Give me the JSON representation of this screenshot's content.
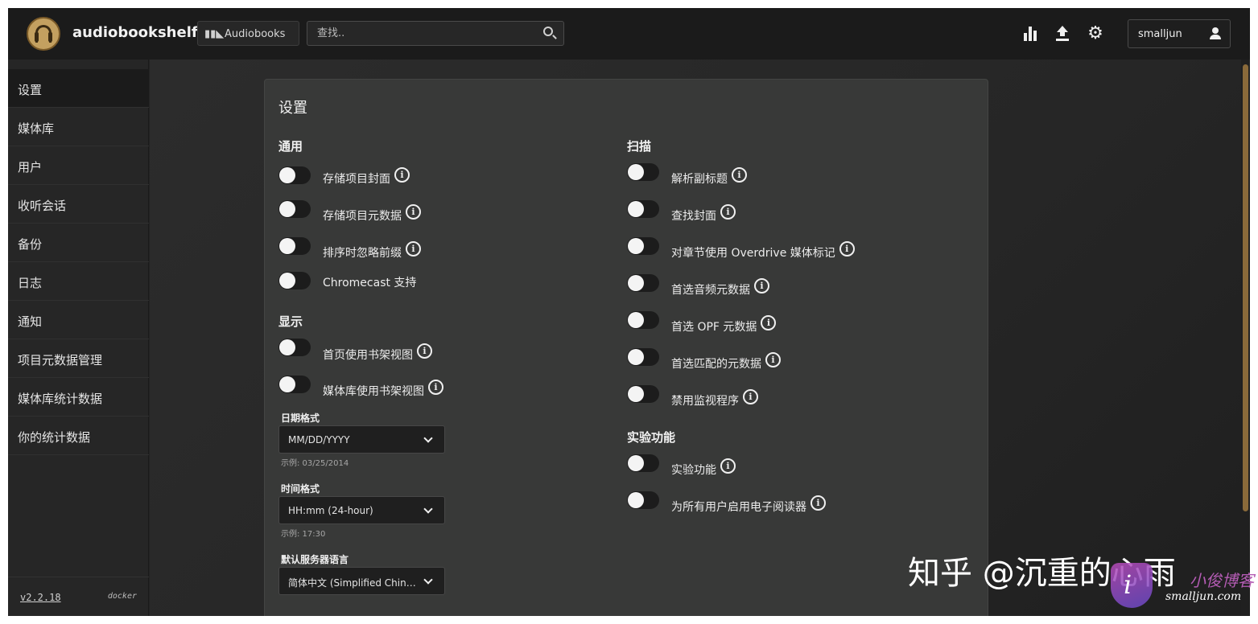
{
  "header": {
    "app_title": "audiobookshelf",
    "library_label": "Audiobooks",
    "search_placeholder": "查找..",
    "username": "smalljun"
  },
  "sidebar": {
    "items": [
      {
        "label": "设置",
        "active": true
      },
      {
        "label": "媒体库"
      },
      {
        "label": "用户"
      },
      {
        "label": "收听会话"
      },
      {
        "label": "备份"
      },
      {
        "label": "日志"
      },
      {
        "label": "通知"
      },
      {
        "label": "项目元数据管理"
      },
      {
        "label": "媒体库统计数据"
      },
      {
        "label": "你的统计数据"
      }
    ],
    "version": "v2.2.18",
    "deployment": "docker"
  },
  "settings": {
    "title": "设置",
    "general": {
      "title": "通用",
      "options": [
        {
          "label": "存储项目封面",
          "info": true,
          "enabled": false
        },
        {
          "label": "存储项目元数据",
          "info": true,
          "enabled": false
        },
        {
          "label": "排序时忽略前缀",
          "info": true,
          "enabled": false
        },
        {
          "label": "Chromecast 支持",
          "info": false,
          "enabled": false
        }
      ]
    },
    "display": {
      "title": "显示",
      "options": [
        {
          "label": "首页使用书架视图",
          "info": true,
          "enabled": false
        },
        {
          "label": "媒体库使用书架视图",
          "info": true,
          "enabled": false
        }
      ],
      "date_format": {
        "label": "日期格式",
        "value": "MM/DD/YYYY",
        "example": "示例: 03/25/2014"
      },
      "time_format": {
        "label": "时间格式",
        "value": "HH:mm (24-hour)",
        "example": "示例: 17:30"
      },
      "language": {
        "label": "默认服务器语言",
        "value": "简体中文 (Simplified Chinese)"
      }
    },
    "scan": {
      "title": "扫描",
      "options": [
        {
          "label": "解析副标题",
          "info": true,
          "enabled": false
        },
        {
          "label": "查找封面",
          "info": true,
          "enabled": false
        },
        {
          "label": "对章节使用 Overdrive 媒体标记",
          "info": true,
          "enabled": false
        },
        {
          "label": "首选音频元数据",
          "info": true,
          "enabled": false
        },
        {
          "label": "首选 OPF 元数据",
          "info": true,
          "enabled": false
        },
        {
          "label": "首选匹配的元数据",
          "info": true,
          "enabled": false
        },
        {
          "label": "禁用监视程序",
          "info": true,
          "enabled": false
        }
      ]
    },
    "experimental": {
      "title": "实验功能",
      "options": [
        {
          "label": "实验功能",
          "info": true,
          "enabled": false
        },
        {
          "label": "为所有用户启用电子阅读器",
          "info": true,
          "enabled": false
        }
      ]
    }
  },
  "watermark": {
    "text": "知乎 @沉重的心雨",
    "badge_letter": "i",
    "cn": "小俊博客",
    "url": "smalljun.com"
  },
  "colors": {
    "header_bg": "#1b1b1b",
    "panel_bg": "#383938",
    "accent": "#8a6a3a"
  }
}
